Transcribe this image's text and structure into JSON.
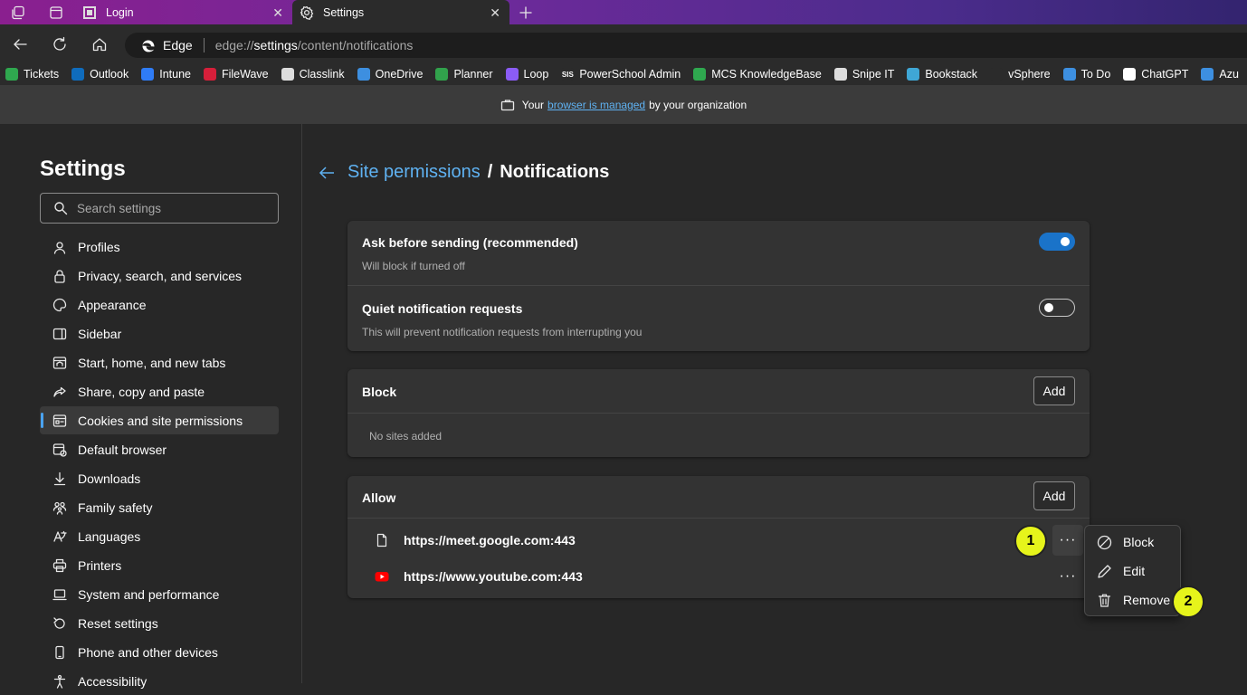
{
  "tabs": [
    {
      "label": "Login"
    },
    {
      "label": "Settings"
    }
  ],
  "omnibox": {
    "browser_name": "Edge",
    "url_prefix": "edge://",
    "url_bold": "settings",
    "url_rest": "/content/notifications"
  },
  "favorites": [
    {
      "label": "Tickets",
      "icon": "green-circle-icon",
      "color": "#2fa84f"
    },
    {
      "label": "Outlook",
      "icon": "outlook-icon",
      "color": "#0f6cbd"
    },
    {
      "label": "Intune",
      "icon": "intune-icon",
      "color": "#2f7cf6"
    },
    {
      "label": "FileWave",
      "icon": "filewave-icon",
      "color": "#d61f3a"
    },
    {
      "label": "Classlink",
      "icon": "classlink-icon",
      "color": "#dddddd"
    },
    {
      "label": "OneDrive",
      "icon": "cloud-icon",
      "color": "#3d8fe0"
    },
    {
      "label": "Planner",
      "icon": "planner-icon",
      "color": "#31a24c"
    },
    {
      "label": "Loop",
      "icon": "loop-icon",
      "color": "#8b5cf6"
    },
    {
      "label": "PowerSchool Admin",
      "icon": "sis-icon",
      "color": "#2b2b2b",
      "badge": "SIS"
    },
    {
      "label": "MCS KnowledgeBase",
      "icon": "green-circle-icon",
      "color": "#2fa84f"
    },
    {
      "label": "Snipe IT",
      "icon": "snipe-icon",
      "color": "#dddddd"
    },
    {
      "label": "Bookstack",
      "icon": "bookstack-icon",
      "color": "#3fa7d6"
    },
    {
      "label": "vSphere",
      "icon": "page-icon",
      "color": "#2b2b2b"
    },
    {
      "label": "To Do",
      "icon": "check-icon",
      "color": "#3d8fe0"
    },
    {
      "label": "ChatGPT",
      "icon": "chatgpt-icon",
      "color": "#ffffff"
    },
    {
      "label": "Azu",
      "icon": "azure-icon",
      "color": "#3d8fe0"
    }
  ],
  "managed": {
    "prefix": "Your",
    "link": "browser is managed",
    "suffix": "by your organization"
  },
  "sidebar": {
    "title": "Settings",
    "search_placeholder": "Search settings",
    "items": [
      {
        "label": "Profiles",
        "icon": "profile-icon"
      },
      {
        "label": "Privacy, search, and services",
        "icon": "lock-icon"
      },
      {
        "label": "Appearance",
        "icon": "palette-icon"
      },
      {
        "label": "Sidebar",
        "icon": "sidebar-icon"
      },
      {
        "label": "Start, home, and new tabs",
        "icon": "home-tabs-icon"
      },
      {
        "label": "Share, copy and paste",
        "icon": "share-icon"
      },
      {
        "label": "Cookies and site permissions",
        "icon": "cookies-icon",
        "active": true
      },
      {
        "label": "Default browser",
        "icon": "browser-icon"
      },
      {
        "label": "Downloads",
        "icon": "download-icon"
      },
      {
        "label": "Family safety",
        "icon": "family-icon"
      },
      {
        "label": "Languages",
        "icon": "language-icon"
      },
      {
        "label": "Printers",
        "icon": "printer-icon"
      },
      {
        "label": "System and performance",
        "icon": "laptop-icon"
      },
      {
        "label": "Reset settings",
        "icon": "reset-icon"
      },
      {
        "label": "Phone and other devices",
        "icon": "phone-icon"
      },
      {
        "label": "Accessibility",
        "icon": "accessibility-icon"
      }
    ]
  },
  "breadcrumb": {
    "parent": "Site permissions",
    "separator": "/",
    "current": "Notifications"
  },
  "settings": {
    "ask": {
      "title": "Ask before sending (recommended)",
      "subtitle": "Will block if turned off",
      "enabled": true
    },
    "quiet": {
      "title": "Quiet notification requests",
      "subtitle": "This will prevent notification requests from interrupting you",
      "enabled": false
    }
  },
  "block": {
    "title": "Block",
    "add_label": "Add",
    "empty": "No sites added"
  },
  "allow": {
    "title": "Allow",
    "add_label": "Add",
    "sites": [
      {
        "url": "https://meet.google.com:443",
        "icon": "page-icon"
      },
      {
        "url": "https://www.youtube.com:443",
        "icon": "youtube-icon"
      }
    ]
  },
  "context_menu": {
    "items": [
      {
        "label": "Block",
        "icon": "block-icon"
      },
      {
        "label": "Edit",
        "icon": "pencil-icon"
      },
      {
        "label": "Remove",
        "icon": "trash-icon"
      }
    ]
  },
  "markers": [
    {
      "label": "1"
    },
    {
      "label": "2"
    }
  ]
}
